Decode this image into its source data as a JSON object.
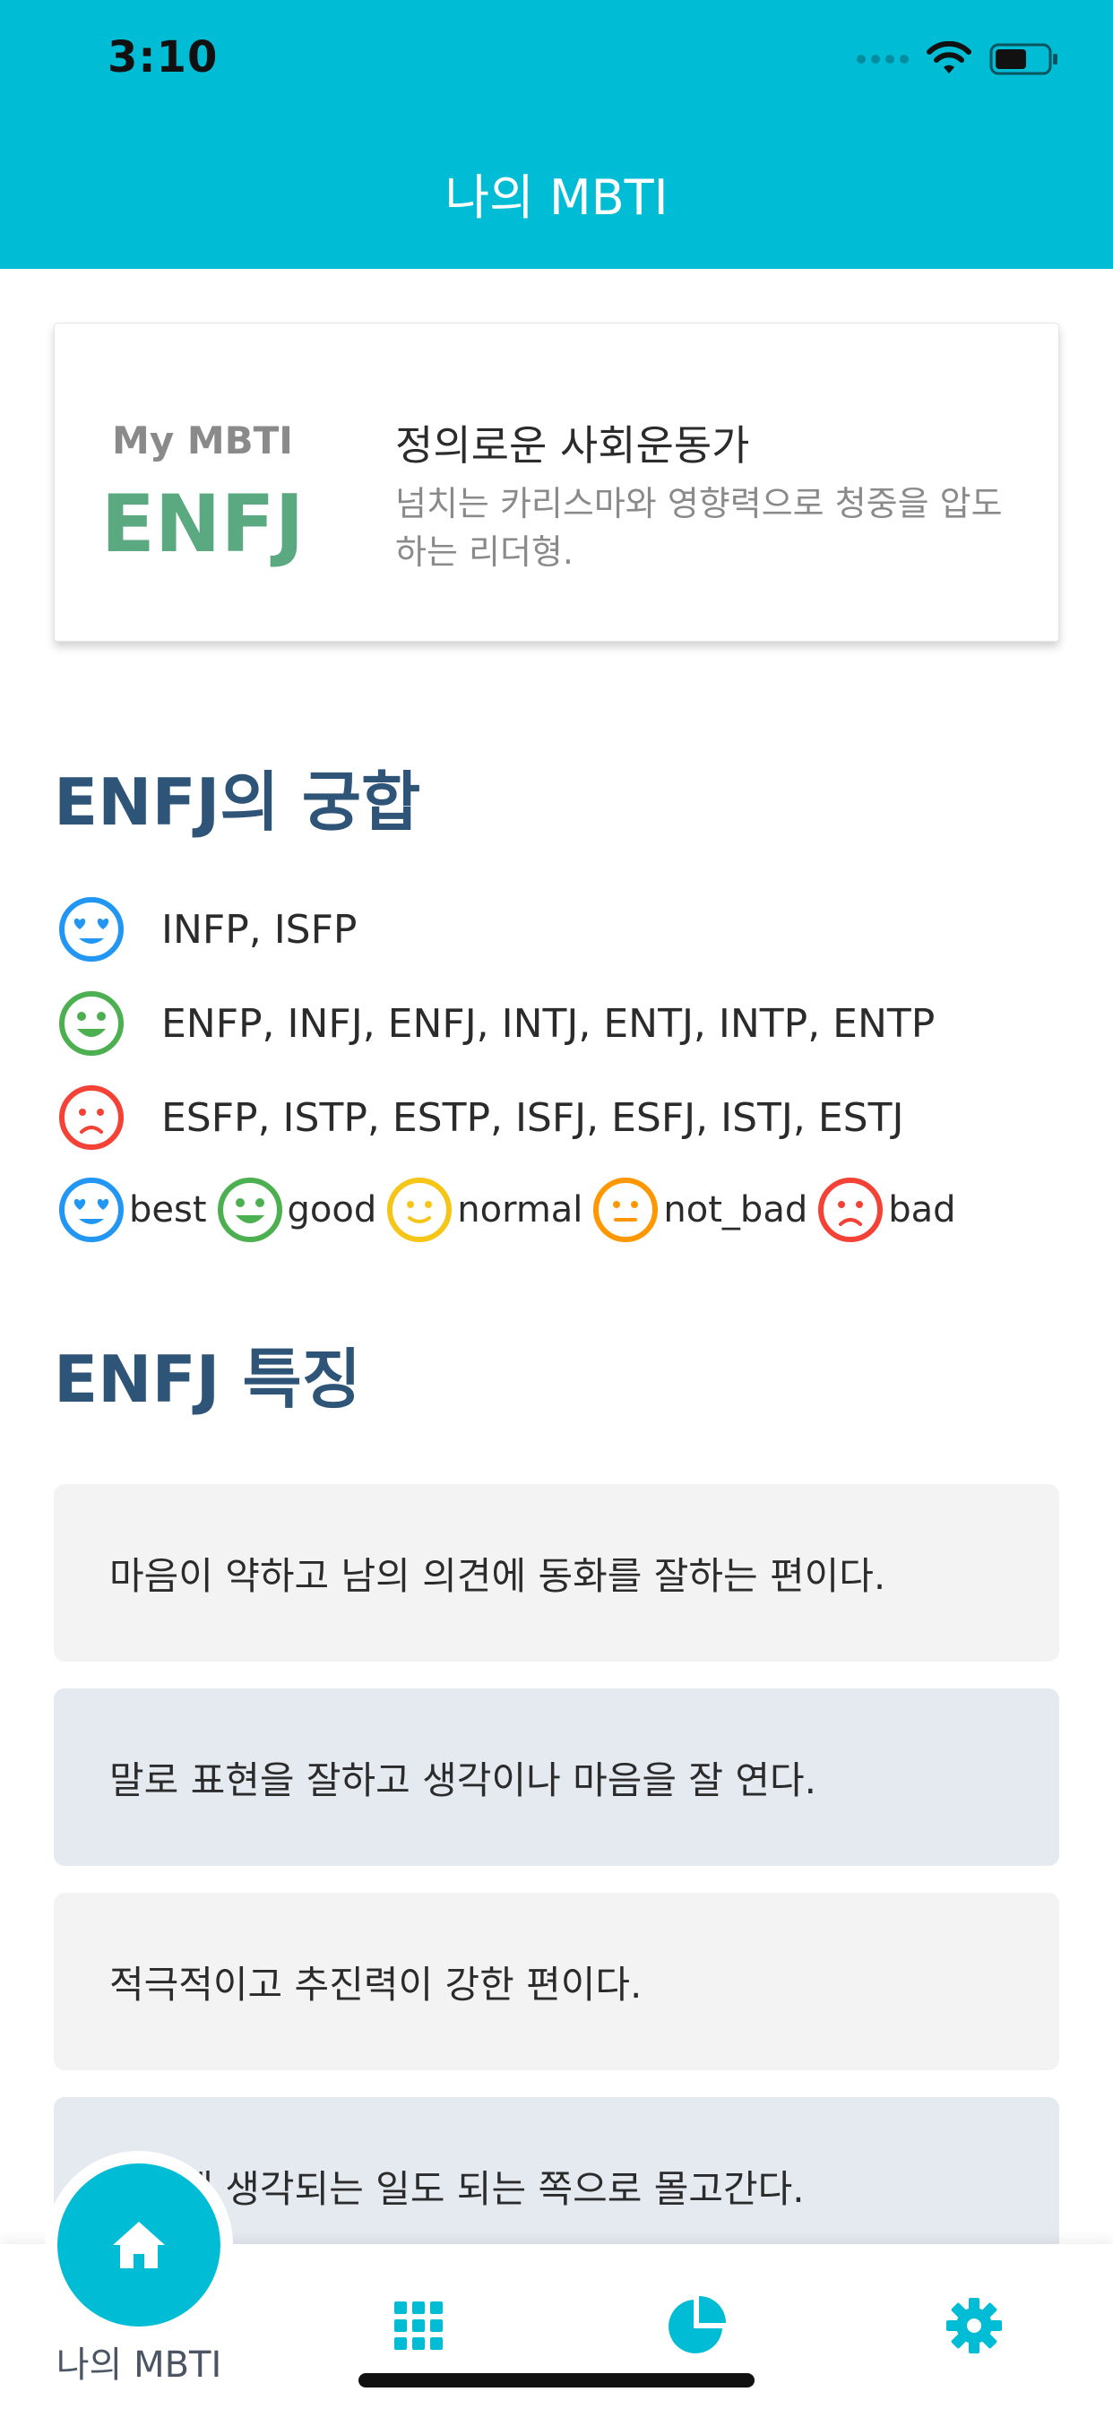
{
  "status_bar": {
    "time": "3:10"
  },
  "header": {
    "title": "나의 MBTI"
  },
  "mbti_card": {
    "label": "My MBTI",
    "type": "ENFJ",
    "title": "정의로운 사회운동가",
    "description": "넘치는 카리스마와 영향력으로 청중을 압도하는 리더형."
  },
  "compatibility": {
    "title": "ENFJ의 궁합",
    "rows": [
      {
        "level": "best",
        "types": "INFP, ISFP"
      },
      {
        "level": "good",
        "types": "ENFP, INFJ, ENFJ, INTJ, ENTJ, INTP, ENTP"
      },
      {
        "level": "bad",
        "types": "ESFP, ISTP, ESTP, ISFJ, ESFJ, ISTJ, ESTJ"
      }
    ],
    "legend": [
      {
        "label": "best",
        "color": "#2196f3",
        "icon": "heart-eyes-face-icon"
      },
      {
        "label": "good",
        "color": "#4caf50",
        "icon": "smiling-face-icon"
      },
      {
        "label": "normal",
        "color": "#f5c518",
        "icon": "slight-smile-face-icon"
      },
      {
        "label": "not_bad",
        "color": "#ff9800",
        "icon": "neutral-face-icon"
      },
      {
        "label": "bad",
        "color": "#f44336",
        "icon": "frowning-face-icon"
      }
    ]
  },
  "features": {
    "title": "ENFJ 특징",
    "items": [
      "마음이 약하고 남의 의견에 동화를 잘하는 편이다.",
      "말로 표현을 잘하고 생각이나 마음을 잘 연다.",
      "적극적이고 추진력이 강한 편이다.",
      "어렵게 생각되는 일도 되는 쪽으로 몰고간다."
    ]
  },
  "tab_bar": {
    "home_label": "나의 MBTI",
    "tabs": [
      "home-icon",
      "grid-icon",
      "pie-chart-icon",
      "gear-icon"
    ]
  },
  "colors": {
    "primary": "#00bcd4",
    "mbti_type": "#5aa981",
    "section_title": "#2e5478"
  }
}
